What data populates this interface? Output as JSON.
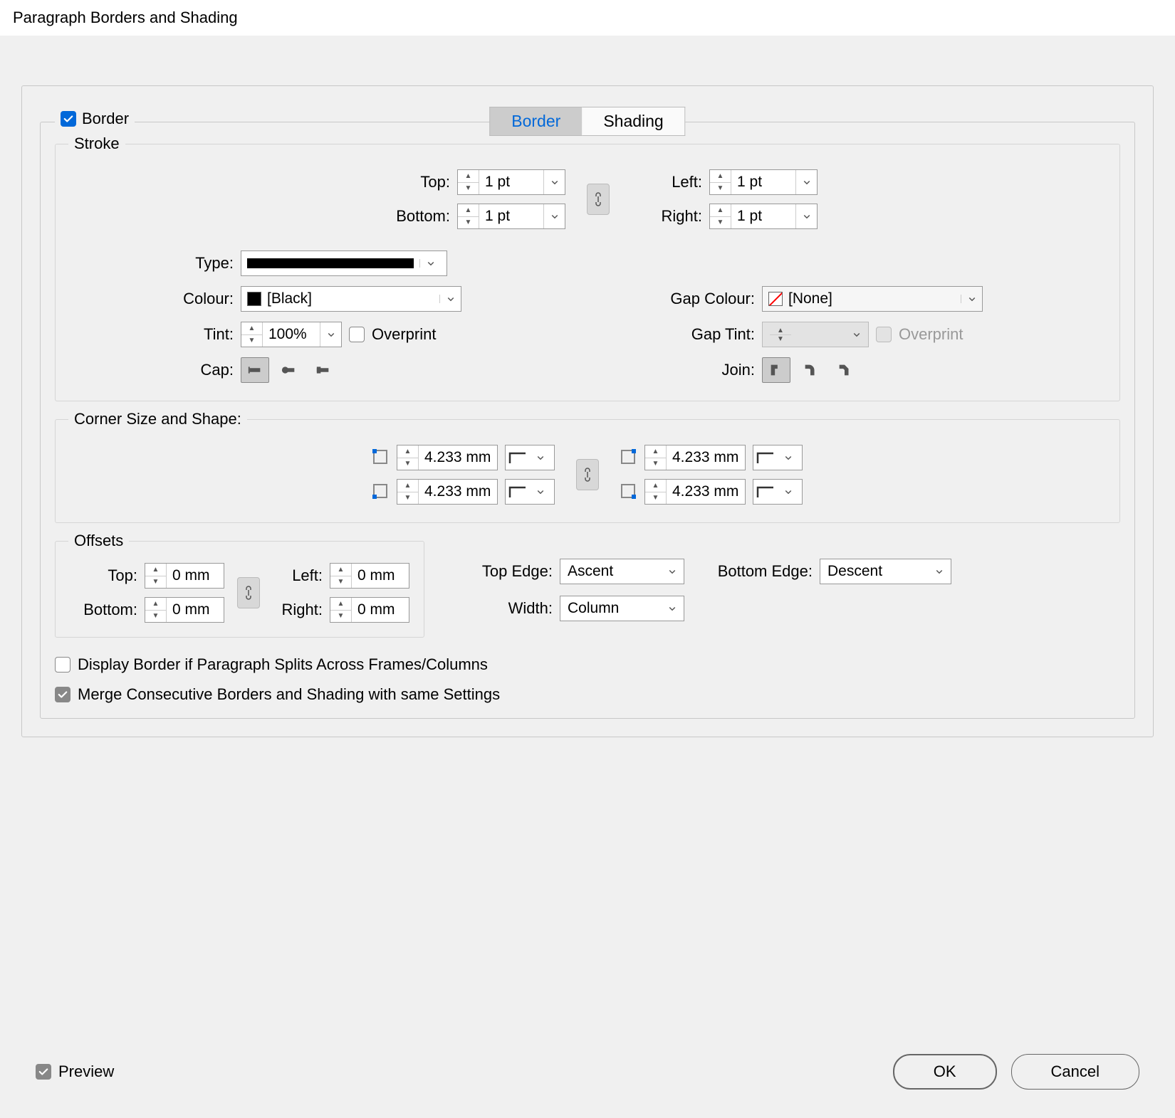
{
  "title": "Paragraph Borders and Shading",
  "tabs": {
    "border": "Border",
    "shading": "Shading"
  },
  "borderGroup": {
    "label": "Border",
    "stroke": {
      "legend": "Stroke",
      "top": {
        "label": "Top:",
        "value": "1 pt"
      },
      "bottom": {
        "label": "Bottom:",
        "value": "1 pt"
      },
      "left": {
        "label": "Left:",
        "value": "1 pt"
      },
      "right": {
        "label": "Right:",
        "value": "1 pt"
      },
      "type": {
        "label": "Type:"
      },
      "colour": {
        "label": "Colour:",
        "value": "[Black]"
      },
      "gapColour": {
        "label": "Gap Colour:",
        "value": "[None]"
      },
      "tint": {
        "label": "Tint:",
        "value": "100%"
      },
      "overprint": "Overprint",
      "gapTint": {
        "label": "Gap Tint:"
      },
      "gapOverprint": "Overprint",
      "cap": "Cap:",
      "join": "Join:"
    },
    "corner": {
      "legend": "Corner Size and Shape:",
      "tl": "4.233 mm",
      "bl": "4.233 mm",
      "tr": "4.233 mm",
      "br": "4.233 mm"
    },
    "offsets": {
      "legend": "Offsets",
      "top": {
        "label": "Top:",
        "value": "0 mm"
      },
      "bottom": {
        "label": "Bottom:",
        "value": "0 mm"
      },
      "left": {
        "label": "Left:",
        "value": "0 mm"
      },
      "right": {
        "label": "Right:",
        "value": "0 mm"
      }
    },
    "topEdge": {
      "label": "Top Edge:",
      "value": "Ascent"
    },
    "bottomEdge": {
      "label": "Bottom Edge:",
      "value": "Descent"
    },
    "width": {
      "label": "Width:",
      "value": "Column"
    },
    "displaySplit": "Display Border if Paragraph Splits Across Frames/Columns",
    "mergeConsecutive": "Merge Consecutive Borders and Shading with same Settings"
  },
  "preview": "Preview",
  "ok": "OK",
  "cancel": "Cancel"
}
